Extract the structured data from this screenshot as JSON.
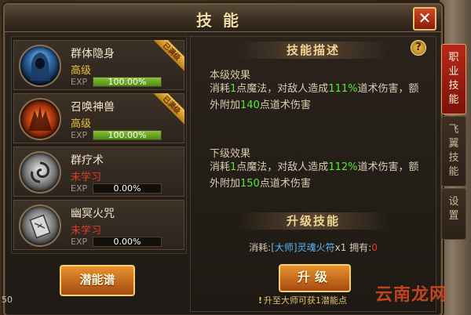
{
  "window": {
    "title": "技能",
    "close_symbol": "✕"
  },
  "skills": [
    {
      "name": "群体隐身",
      "level": "高级",
      "level_color": "#e8c23a",
      "exp_label": "EXP",
      "exp_percent": 100.0,
      "exp_text": "100.00%",
      "badge": "已满级",
      "icon": "hooded-mage-icon"
    },
    {
      "name": "召唤神兽",
      "level": "高级",
      "level_color": "#e8c23a",
      "exp_label": "EXP",
      "exp_percent": 100.0,
      "exp_text": "100.00%",
      "badge": "已满级",
      "icon": "summon-beast-icon"
    },
    {
      "name": "群疗术",
      "level": "未学习",
      "level_color": "#e23a2a",
      "exp_label": "EXP",
      "exp_percent": 0,
      "exp_text": "0.00%",
      "icon": "swirl-heal-icon"
    },
    {
      "name": "幽冥火咒",
      "level": "未学习",
      "level_color": "#e23a2a",
      "exp_label": "EXP",
      "exp_percent": 0,
      "exp_text": "0.00%",
      "icon": "talisman-icon"
    }
  ],
  "potential_button": "潜能谱",
  "description": {
    "header": "技能描述",
    "help": "?",
    "current_title": "本级效果",
    "current_parts": [
      "消耗",
      "1",
      "点魔法，对敌人造成",
      "111%",
      "道术伤害，额外附加",
      "140",
      "点道术伤害"
    ],
    "next_title": "下级效果",
    "next_parts": [
      "消耗",
      "1",
      "点魔法，对敌人造成",
      "112%",
      "道术伤害，额外附加",
      "150",
      "点道术伤害"
    ]
  },
  "upgrade": {
    "header": "升级技能",
    "cost_prefix": "消耗:",
    "cost_item": "[大师]灵魂火符",
    "cost_qty": "x1",
    "owned_label": " 拥有:",
    "owned_value": "0",
    "button": "升级",
    "hint_bang": "!",
    "hint": "升至大师可获1潜能点"
  },
  "side_tabs": [
    "职业技能",
    "飞翼技能",
    "设置"
  ],
  "watermark": "云南龙网",
  "corner_number": "50",
  "colors": {
    "accent_gold": "#f1d494",
    "highlight_green": "#58e83a",
    "active_tab_red": "#b8281a"
  }
}
